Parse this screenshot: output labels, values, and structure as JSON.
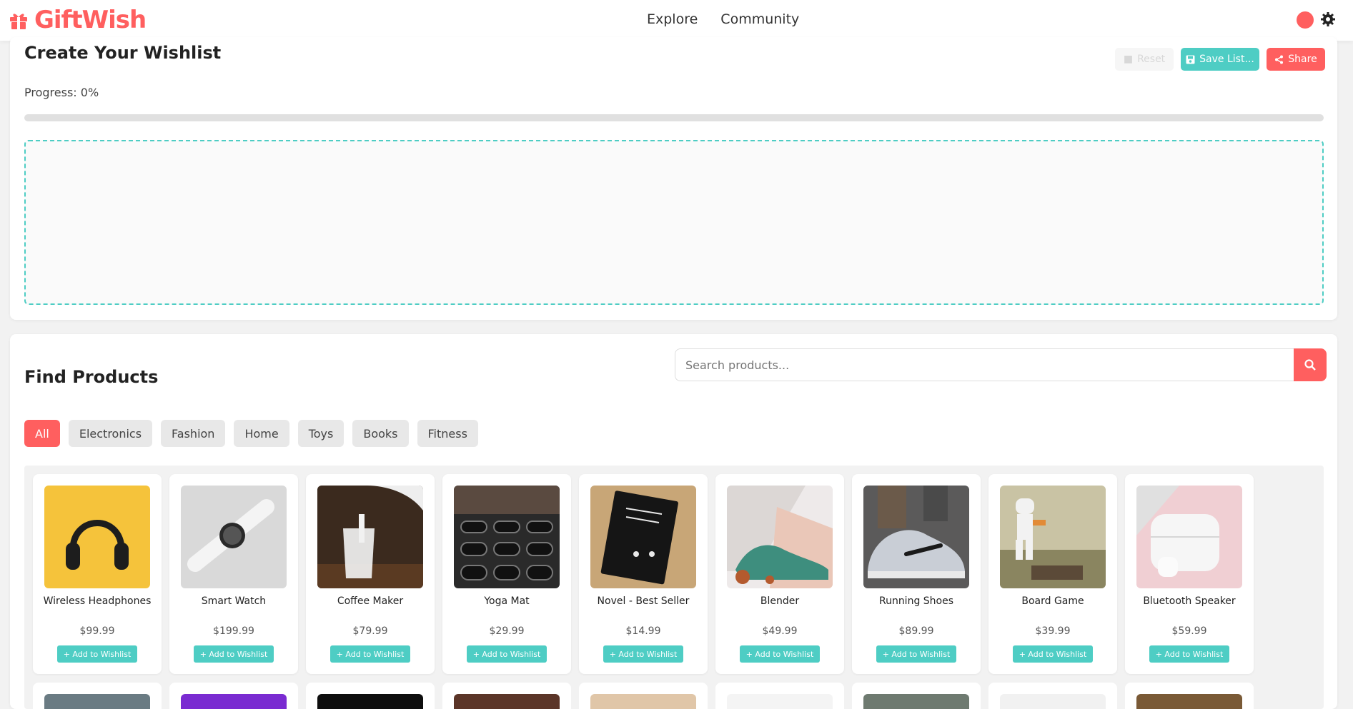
{
  "header": {
    "brand": "GiftWish",
    "nav": [
      "Explore",
      "Community"
    ],
    "theme_dot_color": "#ff5f5f"
  },
  "wishlist": {
    "title": "Create Your Wishlist",
    "progress_text": "Progress: 0%",
    "progress_value": 0,
    "buttons": {
      "ghost_label": "Reset",
      "save_label": "Save List...",
      "share_label": "Share"
    }
  },
  "products": {
    "title": "Find Products",
    "search_placeholder": "Search products...",
    "categories": [
      "All",
      "Electronics",
      "Fashion",
      "Home",
      "Toys",
      "Books",
      "Fitness"
    ],
    "active_category": "All",
    "add_label": "+ Add to Wishlist",
    "items": [
      {
        "name": "Wireless Headphones",
        "price": "$99.99"
      },
      {
        "name": "Smart Watch",
        "price": "$199.99"
      },
      {
        "name": "Coffee Maker",
        "price": "$79.99"
      },
      {
        "name": "Yoga Mat",
        "price": "$29.99"
      },
      {
        "name": "Novel - Best Seller",
        "price": "$14.99"
      },
      {
        "name": "Blender",
        "price": "$49.99"
      },
      {
        "name": "Running Shoes",
        "price": "$89.99"
      },
      {
        "name": "Board Game",
        "price": "$39.99"
      },
      {
        "name": "Bluetooth Speaker",
        "price": "$59.99"
      }
    ]
  },
  "colors": {
    "brand_red": "#ff5f5f",
    "accent_teal": "#4ecdc4"
  }
}
